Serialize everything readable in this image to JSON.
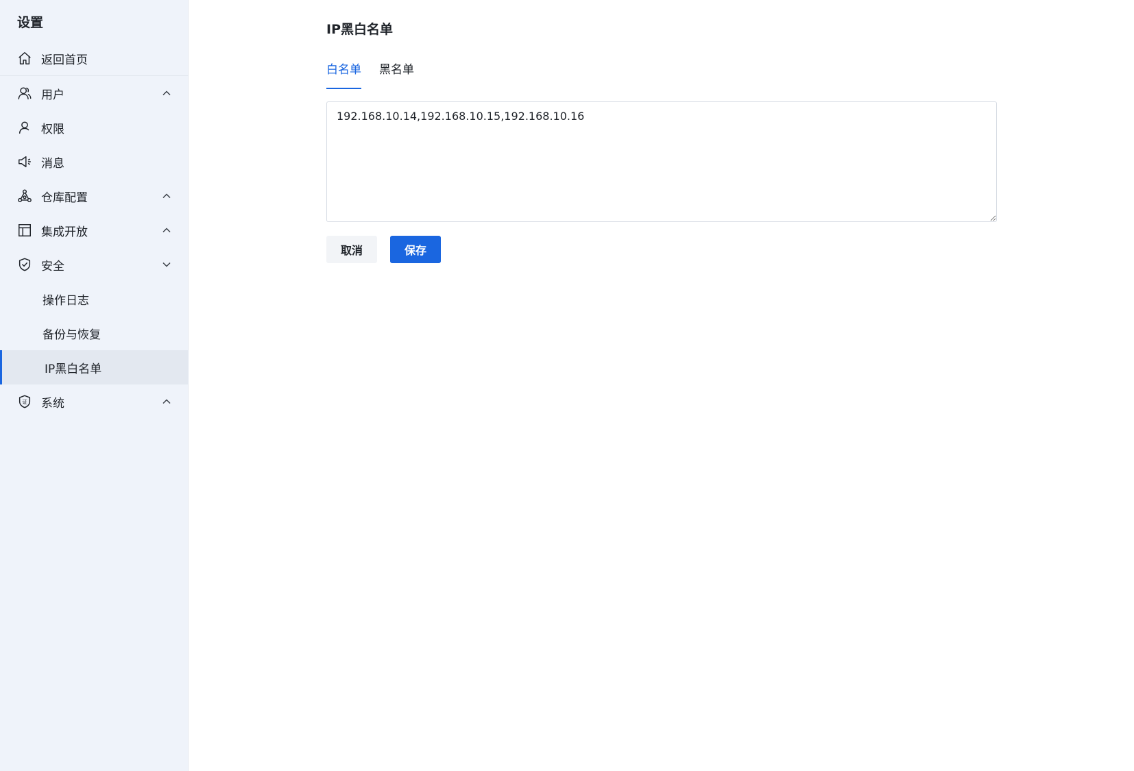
{
  "sidebar": {
    "title": "设置",
    "items": [
      {
        "label": "返回首页",
        "icon": "home-icon"
      },
      {
        "label": "用户",
        "icon": "users-icon",
        "chevron": "up"
      },
      {
        "label": "权限",
        "icon": "user-icon"
      },
      {
        "label": "消息",
        "icon": "megaphone-icon"
      },
      {
        "label": "仓库配置",
        "icon": "network-icon",
        "chevron": "up"
      },
      {
        "label": "集成开放",
        "icon": "layout-icon",
        "chevron": "up"
      },
      {
        "label": "安全",
        "icon": "shield-check-icon",
        "chevron": "down"
      },
      {
        "label": "系统",
        "icon": "certificate-icon",
        "chevron": "up"
      }
    ],
    "security_sub": [
      {
        "label": "操作日志"
      },
      {
        "label": "备份与恢复"
      },
      {
        "label": "IP黑白名单",
        "active": true
      }
    ]
  },
  "main": {
    "title": "IP黑白名单",
    "tabs": [
      {
        "label": "白名单",
        "active": true
      },
      {
        "label": "黑名单"
      }
    ],
    "ip_list": "192.168.10.14,192.168.10.15,192.168.10.16",
    "cancel_label": "取消",
    "save_label": "保存"
  },
  "colors": {
    "accent": "#1a66e0",
    "sidebar_bg": "#eff3fa",
    "active_item_bg": "#e3e8f0"
  }
}
